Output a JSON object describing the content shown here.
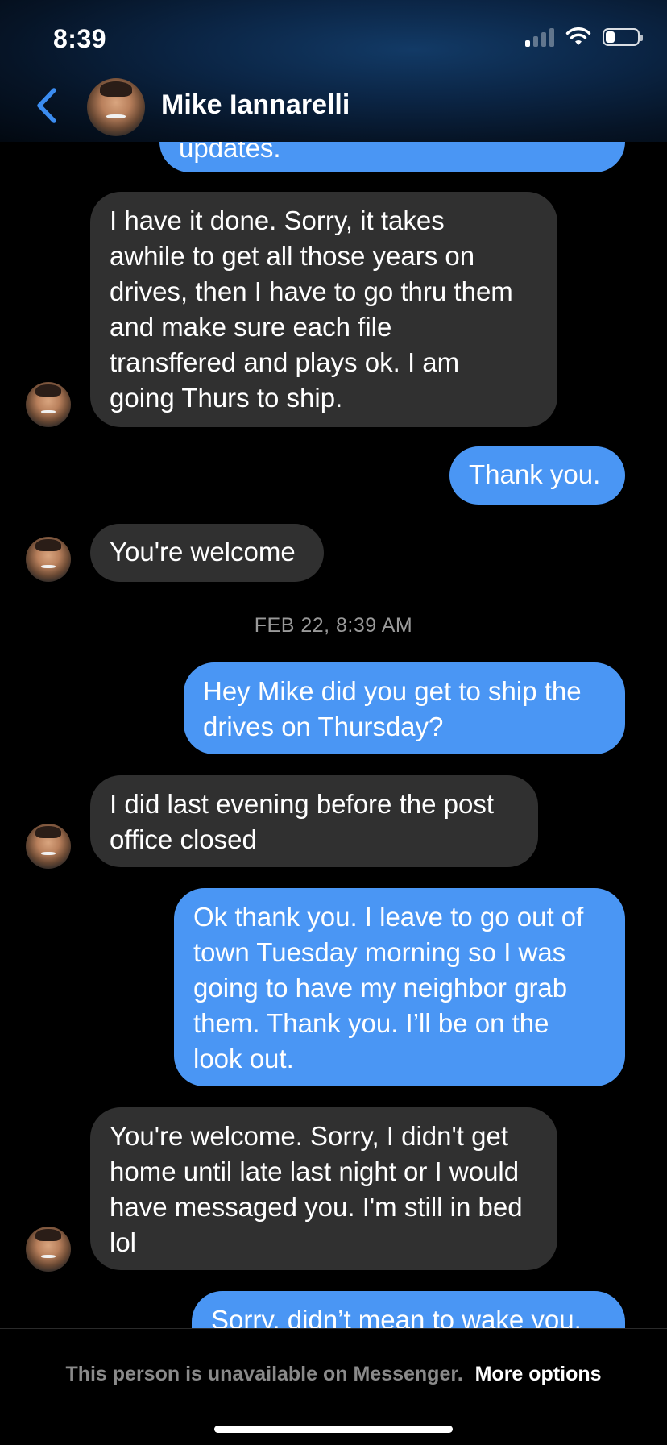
{
  "status_bar": {
    "time": "8:39",
    "signal_bars_filled": 1,
    "battery_level": 0.3
  },
  "header": {
    "contact_name": "Mike Iannarelli",
    "back_icon": "chevron-left-icon"
  },
  "messages": [
    {
      "from": "me",
      "text": "updates."
    },
    {
      "from": "them",
      "text": "I have it done. Sorry, it takes\nawhile to get all those years on\ndrives, then I have to go thru them\nand make sure each file\ntransffered and plays ok. I am\ngoing Thurs to ship."
    },
    {
      "from": "me",
      "text": "Thank you."
    },
    {
      "from": "them",
      "text": "You're welcome"
    },
    {
      "from": "me",
      "text": "Hey Mike did you get to ship the\ndrives on Thursday?"
    },
    {
      "from": "them",
      "text": "I did last evening before the post\noffice closed"
    },
    {
      "from": "me",
      "text": "Ok thank you. I leave to go out of\ntown Tuesday morning so I was\ngoing to have my neighbor grab\nthem. Thank you. I’ll be on the\nlook out."
    },
    {
      "from": "them",
      "text": "You're welcome. Sorry, I didn't get\nhome until late last night or I would\nhave messaged you. I'm still in bed\nlol"
    },
    {
      "from": "me",
      "text": "Sorry, didn’t mean to wake you."
    }
  ],
  "timestamp": "FEB 22, 8:39 AM",
  "footer": {
    "unavailable_text": "This person is unavailable on Messenger.",
    "more_options_label": "More options"
  },
  "colors": {
    "outgoing_bubble": "#4a96f4",
    "incoming_bubble": "#303030",
    "accent": "#3b8cf0"
  }
}
